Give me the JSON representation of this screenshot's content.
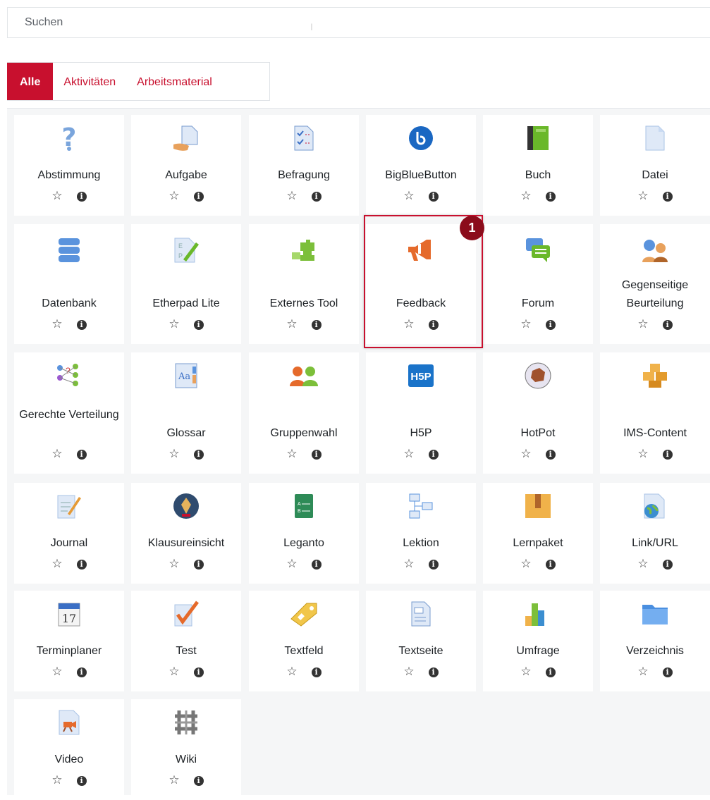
{
  "search": {
    "placeholder": "Suchen"
  },
  "tabs": [
    {
      "label": "Alle",
      "active": true
    },
    {
      "label": "Aktivitäten",
      "active": false
    },
    {
      "label": "Arbeitsmaterial",
      "active": false
    }
  ],
  "accent_color": "#c8102e",
  "callout": {
    "number": "1"
  },
  "modules": [
    {
      "label": "Abstimmung",
      "icon": "question-icon"
    },
    {
      "label": "Aufgabe",
      "icon": "assignment-icon"
    },
    {
      "label": "Befragung",
      "icon": "survey-checklist-icon"
    },
    {
      "label": "BigBlueButton",
      "icon": "bigbluebutton-icon"
    },
    {
      "label": "Buch",
      "icon": "book-icon"
    },
    {
      "label": "Datei",
      "icon": "file-icon"
    },
    {
      "label": "Datenbank",
      "icon": "database-icon"
    },
    {
      "label": "Etherpad Lite",
      "icon": "etherpad-icon"
    },
    {
      "label": "Externes Tool",
      "icon": "puzzle-icon"
    },
    {
      "label": "Feedback",
      "icon": "megaphone-icon"
    },
    {
      "label": "Forum",
      "icon": "forum-icon"
    },
    {
      "label": "Gegenseitige Beurteilung",
      "icon": "workshop-icon"
    },
    {
      "label": "Gerechte Verteilung",
      "icon": "ratingallocate-icon"
    },
    {
      "label": "Glossar",
      "icon": "glossary-icon"
    },
    {
      "label": "Gruppenwahl",
      "icon": "group-choice-icon"
    },
    {
      "label": "H5P",
      "icon": "h5p-icon"
    },
    {
      "label": "HotPot",
      "icon": "hotpot-icon"
    },
    {
      "label": "IMS-Content",
      "icon": "ims-boxes-icon"
    },
    {
      "label": "Journal",
      "icon": "journal-icon"
    },
    {
      "label": "Klausureinsicht",
      "icon": "pen-nib-icon"
    },
    {
      "label": "Leganto",
      "icon": "leganto-icon"
    },
    {
      "label": "Lektion",
      "icon": "lesson-icon"
    },
    {
      "label": "Lernpaket",
      "icon": "package-icon"
    },
    {
      "label": "Link/URL",
      "icon": "url-globe-icon"
    },
    {
      "label": "Terminplaner",
      "icon": "calendar-icon"
    },
    {
      "label": "Test",
      "icon": "quiz-check-icon"
    },
    {
      "label": "Textfeld",
      "icon": "label-tag-icon"
    },
    {
      "label": "Textseite",
      "icon": "page-icon"
    },
    {
      "label": "Umfrage",
      "icon": "bar-chart-icon"
    },
    {
      "label": "Verzeichnis",
      "icon": "folder-icon"
    },
    {
      "label": "Video",
      "icon": "video-icon"
    },
    {
      "label": "Wiki",
      "icon": "wiki-icon"
    }
  ],
  "action_icons": {
    "star": "star-outline-icon",
    "info": "info-icon"
  }
}
